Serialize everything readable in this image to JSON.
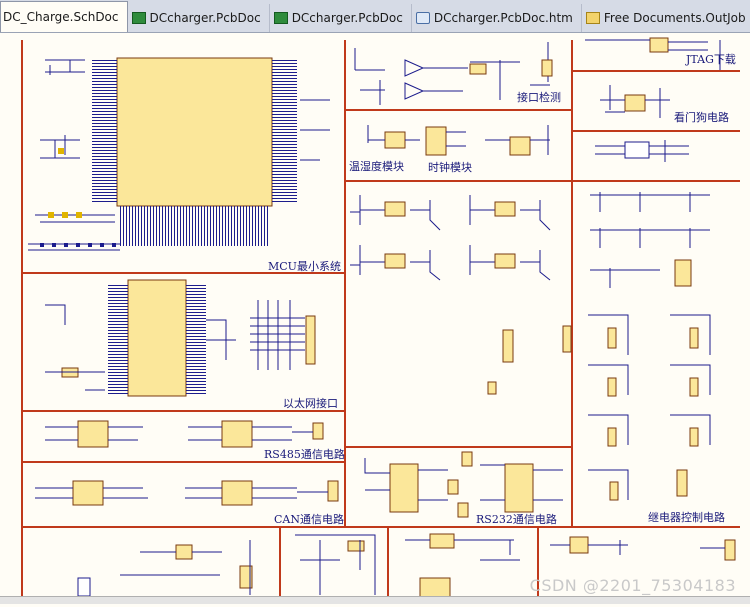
{
  "tabs": [
    {
      "label": "DC_Charge.SchDoc",
      "icon": "schematic-doc-icon",
      "active": true
    },
    {
      "label": "DCcharger.PcbDoc",
      "icon": "pcb-doc-icon",
      "active": false
    },
    {
      "label": "DCcharger.PcbDoc",
      "icon": "pcb-doc-icon",
      "active": false
    },
    {
      "label": "DCcharger.PcbDoc.htm",
      "icon": "htm-doc-icon",
      "active": false
    },
    {
      "label": "Free Documents.OutJob",
      "icon": "outjob-doc-icon",
      "active": false
    }
  ],
  "blocks": {
    "mcu": "MCU最小系统",
    "ethernet": "以太网接口",
    "rs485": "RS485通信电路",
    "can": "CAN通信电路",
    "jtag": "JTAG下载",
    "port_detect": "接口检测",
    "watchdog": "看门狗电路",
    "temp_humidity": "温湿度模块",
    "clock": "时钟模块",
    "rs232": "RS232通信电路",
    "relay": "继电器控制电路"
  },
  "colors": {
    "border": "#c0391b",
    "wire": "#1c1c8c",
    "component": "#fbe79a",
    "sheet": "#fffdf6"
  },
  "watermark": "CSDN @2201_75304183"
}
